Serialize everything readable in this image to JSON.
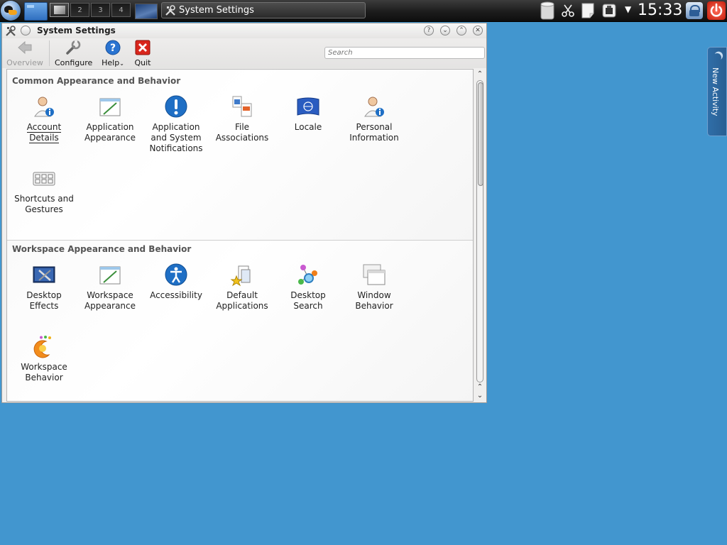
{
  "taskbar": {
    "pager": [
      "1",
      "2",
      "3",
      "4"
    ],
    "task_title": "System Settings",
    "clock": "15:33"
  },
  "window": {
    "title": "System Settings",
    "buttons": {
      "help": "?",
      "minimize": "⌄",
      "maximize": "⌃",
      "close": "✕"
    }
  },
  "toolbar": {
    "overview": "Overview",
    "configure": "Configure",
    "help": "Help",
    "quit": "Quit",
    "search_placeholder": "Search"
  },
  "sections": {
    "common": {
      "title": "Common Appearance and Behavior",
      "items": [
        {
          "label": "Account Details",
          "icon": "user-info-icon"
        },
        {
          "label": "Application Appearance",
          "icon": "appearance-icon"
        },
        {
          "label": "Application and System Notifications",
          "icon": "notification-icon"
        },
        {
          "label": "File Associations",
          "icon": "file-associations-icon"
        },
        {
          "label": "Locale",
          "icon": "un-flag-icon"
        },
        {
          "label": "Personal Information",
          "icon": "user-info-icon"
        },
        {
          "label": "Shortcuts and Gestures",
          "icon": "keyboard-icon"
        }
      ]
    },
    "workspace": {
      "title": "Workspace Appearance and Behavior",
      "items": [
        {
          "label": "Desktop Effects",
          "icon": "desktop-effects-icon"
        },
        {
          "label": "Workspace Appearance",
          "icon": "appearance-icon"
        },
        {
          "label": "Accessibility",
          "icon": "accessibility-icon"
        },
        {
          "label": "Default Applications",
          "icon": "default-apps-icon"
        },
        {
          "label": "Desktop Search",
          "icon": "desktop-search-icon"
        },
        {
          "label": "Window Behavior",
          "icon": "windows-icon"
        },
        {
          "label": "Workspace Behavior",
          "icon": "workspace-behavior-icon"
        }
      ]
    }
  },
  "side_panel": {
    "new_activity": "New Activity"
  },
  "colors": {
    "desktop": "#4296cf",
    "accent": "#1f6fc5",
    "quit_red": "#d9261c"
  }
}
